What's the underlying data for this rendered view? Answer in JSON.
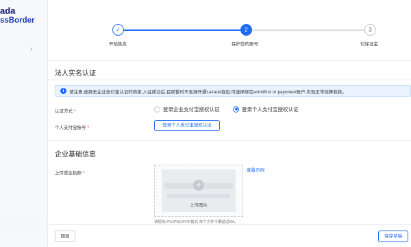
{
  "brand": {
    "line1": "ada",
    "line2": "ssBorder"
  },
  "sidebar": {
    "expand_icon": "chevron-right-icon",
    "expand_glyph": "›"
  },
  "stepper": {
    "steps": [
      {
        "number": "✓",
        "label": "开始售卖",
        "state": "done"
      },
      {
        "number": "2",
        "label": "保护您的账号",
        "state": "active"
      },
      {
        "number": "3",
        "label": "付保证金",
        "state": "pending"
      }
    ]
  },
  "legal": {
    "title": "法人实名认证",
    "notice_icon": "info-icon",
    "notice_glyph": "i",
    "notice": "请注意,选择无企业支付宝认证的商家,入驻成功后,目前暂时不支持开通Lazada钱包;可选择绑定worldfirst or payoneer账户,实现正常结算收款。",
    "auth_method_label": "认证方式",
    "option_enterprise": "登录企业支付宝授权认证",
    "option_personal": "登录个人支付宝授权认证",
    "selected": "option_personal",
    "account_label": "个人支付宝账号",
    "auth_button": "登录个人支付宝授权认证"
  },
  "enterprise": {
    "title": "企业基础信息",
    "license_label": "上传营业执照",
    "required_mark": "*",
    "upload_label": "上传图片",
    "upload_icon": "plus-icon",
    "upload_glyph": "+",
    "example_link": "查看示例",
    "upload_hint": "请使用JPG/PNG/PDF格式,单个文件不要超过5M。"
  },
  "footer": {
    "back": "回退",
    "save": "保存草稿"
  },
  "colors": {
    "primary": "#1f6af5",
    "notice_bg": "#e9f2ff",
    "brand_dark": "#0f146d",
    "brand_blue": "#1a3bb8",
    "required": "#e02020"
  }
}
